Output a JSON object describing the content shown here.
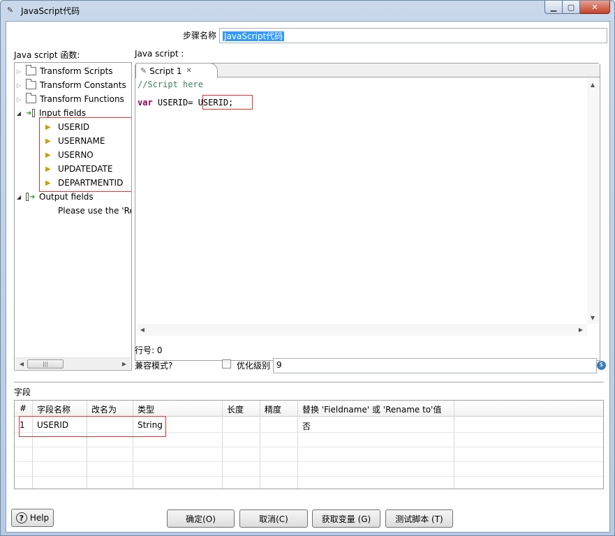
{
  "window": {
    "title": "JavaScript代码"
  },
  "step": {
    "label": "步骤名称",
    "value": "JavaScript代码"
  },
  "functions": {
    "label": "Java script 函数:",
    "tree": {
      "transform_scripts": "Transform Scripts",
      "transform_constants": "Transform Constants",
      "transform_functions": "Transform Functions",
      "input_fields": "Input fields",
      "input_items": [
        "USERID",
        "USERNAME",
        "USERNO",
        "UPDATEDATE",
        "DEPARTMENTID"
      ],
      "output_fields": "Output fields",
      "output_hint": "Please use the 'Re"
    }
  },
  "script": {
    "label": "Java script :",
    "tab": "Script 1",
    "comment": "//Script here",
    "keyword": "var",
    "assign": " USERID=",
    "value": " USERID;"
  },
  "status": {
    "line_label": "行号: 0",
    "compat_label": "兼容模式?",
    "opt_label": "优化级别",
    "opt_value": "9"
  },
  "fields": {
    "section_label": "字段",
    "columns": [
      "#",
      "字段名称",
      "改名为",
      "类型",
      "长度",
      "精度",
      "替换 'Fieldname' 或 'Rename to'值"
    ],
    "rows": [
      {
        "num": "1",
        "name": "USERID",
        "rename": "",
        "type": "String",
        "length": "",
        "precision": "",
        "replace": "否"
      }
    ]
  },
  "buttons": {
    "help": "Help",
    "ok": "确定(O)",
    "cancel": "取消(C)",
    "get_vars": "获取变量 (G)",
    "test": "测试脚本 (T)"
  }
}
